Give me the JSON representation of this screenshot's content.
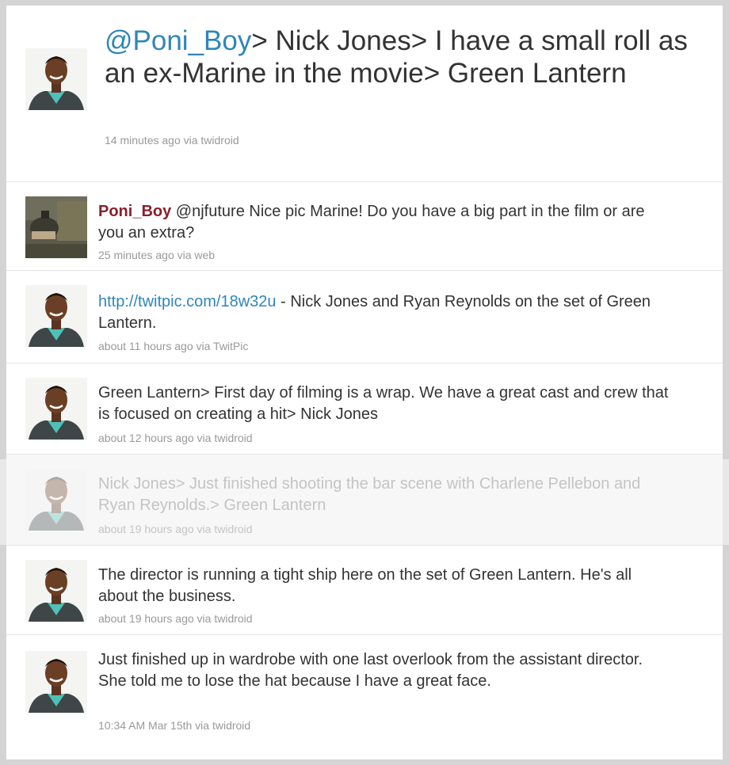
{
  "hero": {
    "mention": "@Poni_Boy",
    "text": "> Nick Jones> I have a small roll as an ex-Marine in the movie> Green Lantern",
    "meta": "14 minutes ago via twidroid"
  },
  "tweets": [
    {
      "user": "Poni_Boy",
      "text": " @njfuture Nice pic Marine! Do you have a big part in the film or are you an extra?",
      "meta": "25 minutes ago via web"
    },
    {
      "link": "http://twitpic.com/18w32u",
      "text": " - Nick Jones and Ryan Reynolds on the set of Green Lantern.",
      "meta": "about 11 hours ago via TwitPic"
    },
    {
      "text": "Green Lantern> First day of filming is a wrap. We have a great cast and crew that is focused on creating a hit> Nick Jones",
      "meta": "about 12 hours ago via twidroid"
    },
    {
      "text": "Nick Jones> Just finished shooting the bar scene with Charlene Pellebon and Ryan Reynolds.> Green Lantern",
      "meta": "about 19 hours ago via twidroid"
    },
    {
      "text": "The director is running a tight ship here on the set of Green Lantern. He's all about the business.",
      "meta": "about 19 hours ago via twidroid"
    },
    {
      "text": "Just finished up in wardrobe with one last overlook from the assistant director. She told me to lose the hat because I have a great face.",
      "meta": "10:34 AM Mar 15th via twidroid"
    }
  ]
}
